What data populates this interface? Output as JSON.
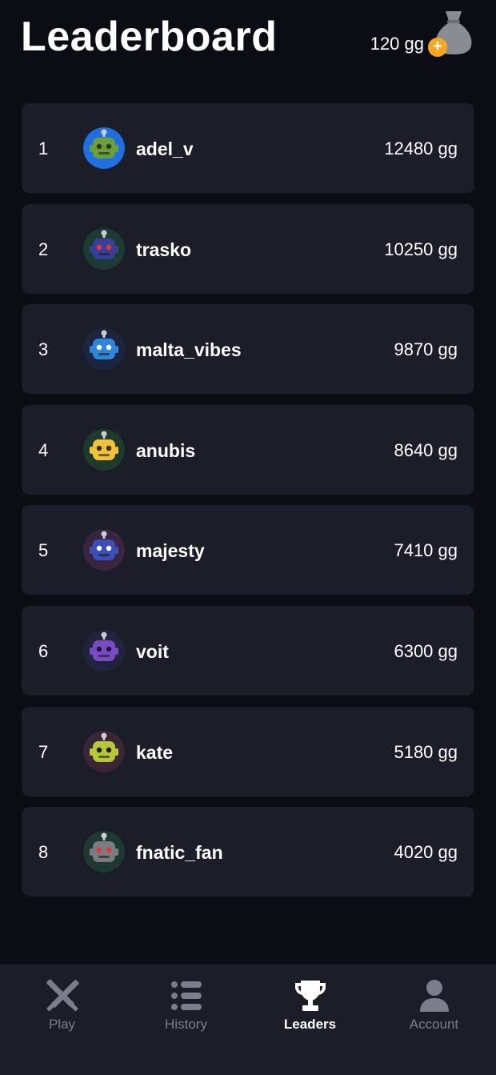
{
  "header": {
    "title": "Leaderboard",
    "balance": "120 gg",
    "plus_symbol": "+",
    "wallet_icon": "money-bag-icon"
  },
  "leaders": [
    {
      "rank": "1",
      "name": "adel_v",
      "score": "12480 gg",
      "avatar": {
        "ring": "#1e6fe0",
        "bg": "#1e6fe0",
        "face": "#6a9e3a",
        "eyes": "#2a3a1a"
      }
    },
    {
      "rank": "2",
      "name": "trasko",
      "score": "10250 gg",
      "avatar": {
        "ring": "#1c3b33",
        "bg": "#1c3b33",
        "face": "#3a3f96",
        "eyes": "#e03a3a"
      }
    },
    {
      "rank": "3",
      "name": "malta_vibes",
      "score": "9870 gg",
      "avatar": {
        "ring": "#1c2540",
        "bg": "#1c2540",
        "face": "#2f86d8",
        "eyes": "#ffffff"
      }
    },
    {
      "rank": "4",
      "name": "anubis",
      "score": "8640 gg",
      "avatar": {
        "ring": "#1d3a2a",
        "bg": "#1d3a2a",
        "face": "#f0c23a",
        "eyes": "#3a2a10"
      }
    },
    {
      "rank": "5",
      "name": "majesty",
      "score": "7410 gg",
      "avatar": {
        "ring": "#3a2540",
        "bg": "#3a2540",
        "face": "#3b4fb5",
        "eyes": "#ffffff"
      }
    },
    {
      "rank": "6",
      "name": "voit",
      "score": "6300 gg",
      "avatar": {
        "ring": "#22233f",
        "bg": "#22233f",
        "face": "#7a4cc4",
        "eyes": "#1e1540"
      }
    },
    {
      "rank": "7",
      "name": "kate",
      "score": "5180 gg",
      "avatar": {
        "ring": "#3a2535",
        "bg": "#3a2535",
        "face": "#b8c63a",
        "eyes": "#1a1e10"
      }
    },
    {
      "rank": "8",
      "name": "fnatic_fan",
      "score": "4020 gg",
      "avatar": {
        "ring": "#1e3a30",
        "bg": "#1e3a30",
        "face": "#7a7c82",
        "eyes": "#e03a3a"
      }
    }
  ],
  "nav": {
    "tabs": [
      {
        "label": "Play",
        "icon": "crossed-swords-icon",
        "active": false
      },
      {
        "label": "History",
        "icon": "list-icon",
        "active": false
      },
      {
        "label": "Leaders",
        "icon": "trophy-icon",
        "active": true
      },
      {
        "label": "Account",
        "icon": "user-icon",
        "active": false
      }
    ]
  },
  "colors": {
    "background": "#0b0d14",
    "card": "#1b1d29",
    "accent_coin": "#f5a623",
    "inactive": "#7b7d8a"
  }
}
